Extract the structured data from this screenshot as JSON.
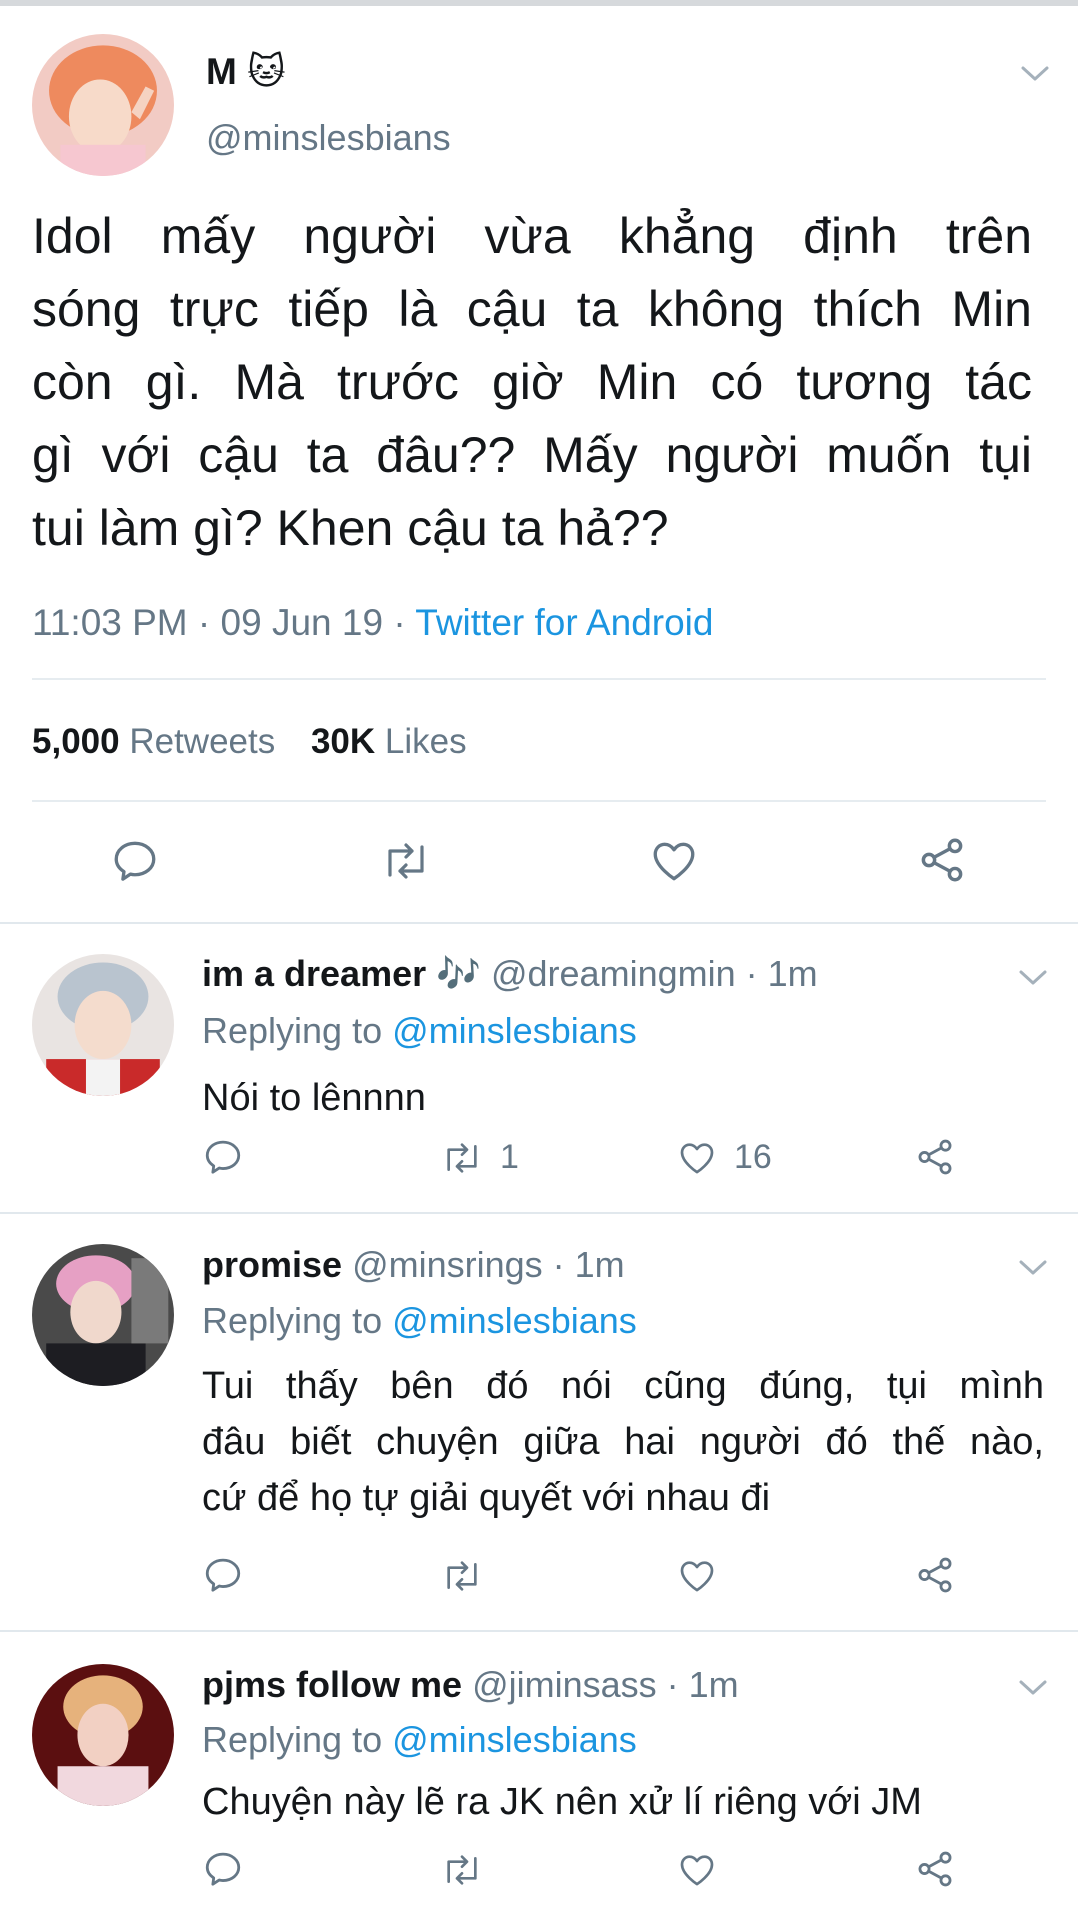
{
  "main_tweet": {
    "display_name": "M",
    "name_emoji": "🐱",
    "handle": "@minslesbians",
    "text_lines": [
      "Idol mấy người vừa khẳng định trên",
      "sóng trực tiếp là cậu ta không thích Min",
      "còn gì. Mà trước giờ Min có tương tác",
      "gì với cậu ta đâu?? Mấy người muốn tụi",
      "tui làm gì? Khen cậu ta hả??"
    ],
    "time": "11:03 PM",
    "date": "09 Jun 19",
    "dot": "·",
    "source": "Twitter for Android",
    "retweets_count": "5,000",
    "retweets_label": "Retweets",
    "likes_count": "30K",
    "likes_label": "Likes"
  },
  "replies": [
    {
      "display_name": "im a dreamer",
      "name_emoji": "🎶",
      "handle": "@dreamingmin",
      "time": "· 1m",
      "replying_prefix": "Replying to",
      "replying_to": "@minslesbians",
      "text_lines": [
        "Nói to lênnnn"
      ],
      "retweets": "1",
      "likes": "16"
    },
    {
      "display_name": "promise",
      "handle": "@minsrings",
      "time": "· 1m",
      "replying_prefix": "Replying to",
      "replying_to": "@minslesbians",
      "text_lines": [
        "Tui thấy bên đó nói cũng đúng, tụi mình",
        "đâu biết chuyện giữa hai người đó thế nào,",
        "cứ để họ tự giải quyết với nhau đi"
      ],
      "retweets": "",
      "likes": ""
    },
    {
      "display_name": "pjms follow me",
      "handle": "@jiminsass",
      "time": "· 1m",
      "replying_prefix": "Replying to",
      "replying_to": "@minslesbians",
      "text_lines": [
        "Chuyện này lẽ ra JK nên xử lí riêng với JM"
      ],
      "retweets": "",
      "likes": ""
    }
  ],
  "icons": [
    "chevron-down-icon",
    "reply-icon",
    "retweet-icon",
    "like-icon",
    "share-icon"
  ],
  "colors": {
    "link": "#1b95e0",
    "muted": "#657786",
    "text": "#14171a",
    "divider": "#e6ecf0"
  }
}
